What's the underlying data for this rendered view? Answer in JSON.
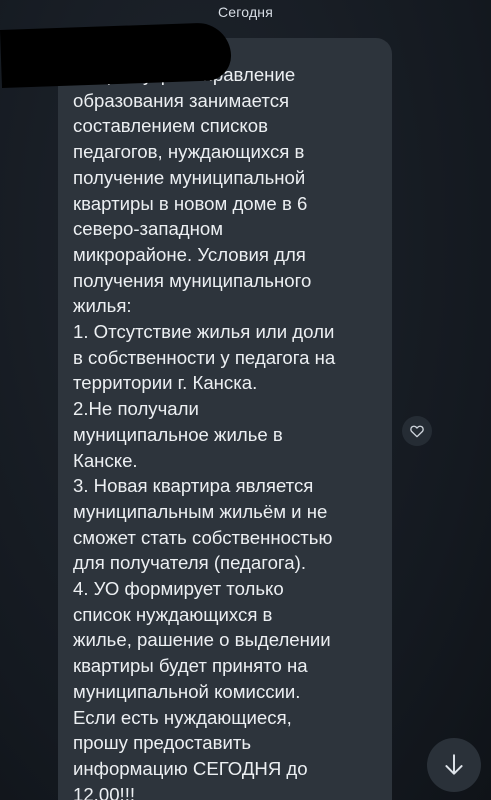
{
  "header": {
    "date_label": "Сегодня"
  },
  "message": {
    "text": "Доброе утро! Управление\nобразования занимается\nсоставлением списков\nпедагогов, нуждающихся в\nполучение муниципальной\nквартиры в новом доме в 6\nсеверо-западном\nмикрорайоне. Условия для\nполучения муниципального\nжилья:\n1. Отсутствие жилья или доли\nв собственности у педагога на\nтерритории г. Канска.\n2.Не получали\nмуниципальное жилье в\nКанске.\n3. Новая квартира является\nмуниципальным жильём и не\nсможет стать собственностью\nдля получателя (педагога).\n4. УО формирует только\nсписок нуждающихся в\nжилье, рашение о выделении\nквартиры будет принято на\nмуниципальной комиссии.\nЕсли есть нуждающиеся,\nпрошу предоставить\nинформацию СЕГОДНЯ до\n12.00!!!"
  },
  "icons": {
    "reaction": "heart-icon",
    "scroll": "arrow-down-icon"
  },
  "colors": {
    "background": "#151a21",
    "bubble": "#2d343c",
    "text": "#eceff2"
  }
}
